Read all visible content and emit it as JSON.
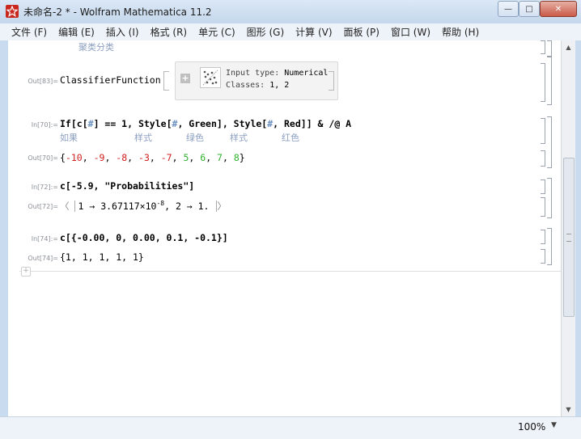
{
  "window": {
    "title": "未命名-2 * - Wolfram Mathematica 11.2",
    "min_glyph": "—",
    "max_glyph": "□",
    "close_glyph": "✕"
  },
  "menu": [
    "文件 (F)",
    "编辑 (E)",
    "插入 (I)",
    "格式 (R)",
    "单元 (C)",
    "图形 (G)",
    "计算 (V)",
    "面板 (P)",
    "窗口 (W)",
    "帮助 (H)"
  ],
  "cells": {
    "top_hint": "聚类分类",
    "out83": {
      "label": "Out[83]=",
      "head": "ClassifierFunction",
      "input_type_key": "Input type:",
      "input_type_val": "Numerical",
      "classes_key": "Classes:",
      "classes_val": "1, 2",
      "plus": "+"
    },
    "in70": {
      "label": "In[70]:=",
      "code_if": "If[c[",
      "code_slot1": "#",
      "code_eq": "] == 1, Style[",
      "code_slot2": "#",
      "code_green": ", Green], Style[",
      "code_slot3": "#",
      "code_red": ", Red]] & /@ A",
      "hint_if": "如果",
      "hint_style1": "样式",
      "hint_green": "绿色",
      "hint_style2": "样式",
      "hint_red": "红色"
    },
    "out70": {
      "label": "Out[70]=",
      "open": "{",
      "v1": "-10",
      "v2": "-9",
      "v3": "-8",
      "v4": "-3",
      "v5": "-7",
      "v6": "5",
      "v7": "6",
      "v8": "7",
      "v9": "8",
      "sep": ", ",
      "close": "}"
    },
    "in72": {
      "label": "In[72]:=",
      "code": "c[-5.9, \"Probabilities\"]"
    },
    "out72": {
      "label": "Out[72]=",
      "open": "〈",
      "k1": "1",
      "arrow": "→",
      "mantissa": "3.67117",
      "times": "×",
      "base": "10",
      "exp": "-8",
      "rest": ", 2 → 1.",
      "close": "〉"
    },
    "in74": {
      "label": "In[74]:=",
      "code": "c[{-0.00, 0, 0.00, 0.1, -0.1}]"
    },
    "out74": {
      "label": "Out[74]=",
      "value": "{1, 1, 1, 1, 1}"
    },
    "insert_plus": "+"
  },
  "status": {
    "zoom": "100%",
    "zoom_arrow": "▼"
  },
  "colors": {
    "negative": "#d21f1f",
    "positive": "#30b230",
    "hint": "#8c9fc1"
  }
}
